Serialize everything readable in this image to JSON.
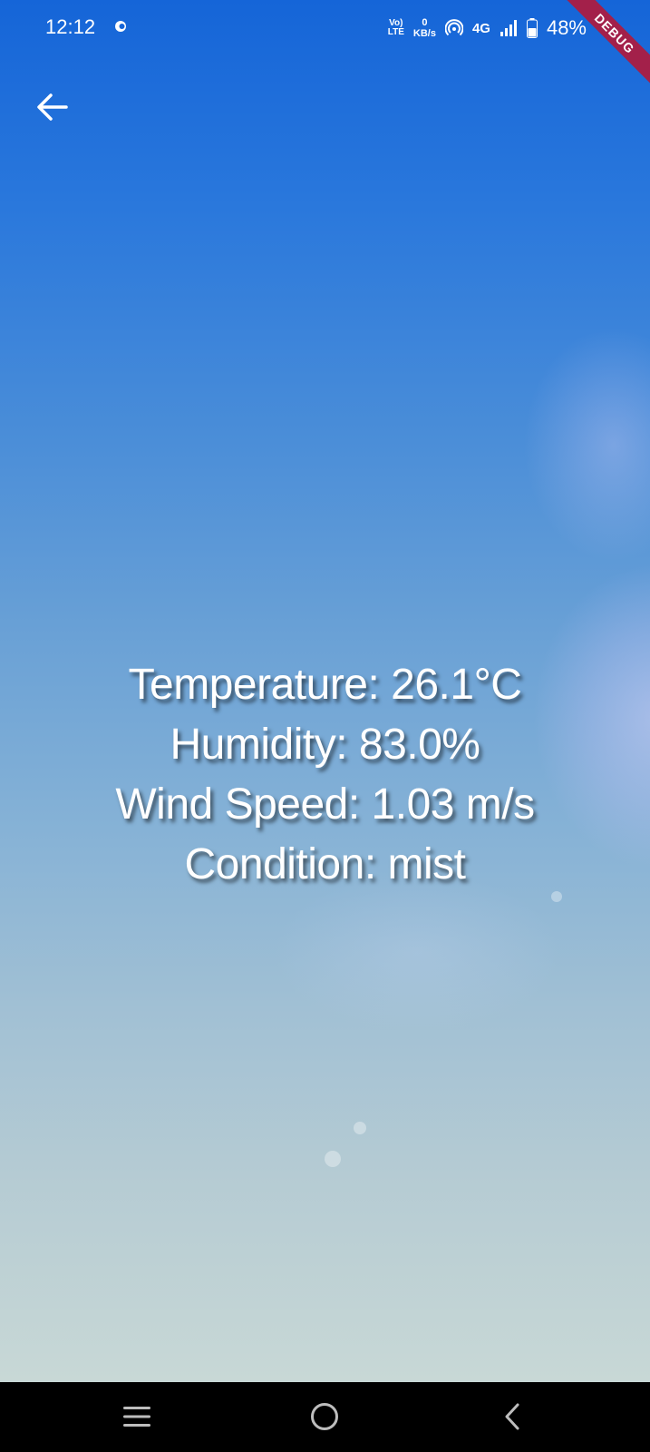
{
  "status_bar": {
    "time": "12:12",
    "volte_top": "Vo)",
    "volte_bottom": "LTE",
    "net_speed_value": "0",
    "net_speed_unit": "KB/s",
    "network_type": "4G",
    "battery_percent": "48%"
  },
  "debug_banner": "DEBUG",
  "weather": {
    "temperature": "Temperature: 26.1°C",
    "humidity": "Humidity: 83.0%",
    "wind_speed": "Wind Speed: 1.03 m/s",
    "condition": "Condition: mist"
  },
  "icons": {
    "back": "arrow-back-icon",
    "nav_recents": "menu-lines-icon",
    "nav_home": "circle-home-icon",
    "nav_back": "chevron-left-icon"
  },
  "colors": {
    "sky_top": "#1565d8",
    "sky_bottom": "#c8d8d6",
    "debug_banner": "#a3204a",
    "nav_bar": "#000000"
  }
}
